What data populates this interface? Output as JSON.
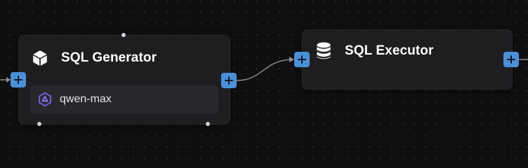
{
  "nodes": {
    "sql_generator": {
      "title": "SQL Generator",
      "icon": "cube-icon",
      "model": {
        "name": "qwen-max",
        "icon": "qwen-logo-icon"
      }
    },
    "sql_executor": {
      "title": "SQL Executor",
      "icon": "database-icon"
    }
  },
  "colors": {
    "canvas_bg": "#0f0f10",
    "node_bg": "#1e1e21",
    "port": "#4a90d9",
    "edge": "#8a8a92",
    "qwen_logo": "#6b5bd6"
  }
}
